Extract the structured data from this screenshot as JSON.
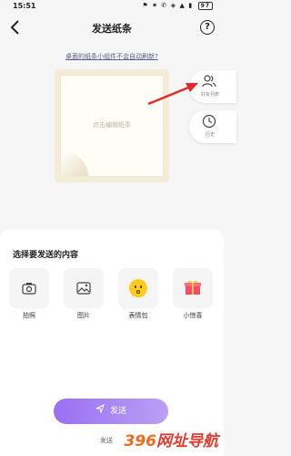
{
  "status_bar": {
    "time": "15:51",
    "icons": "⚑ ✷ ✆ ◈ ▲ ▮",
    "battery": "97"
  },
  "header": {
    "title": "发送纸条",
    "back_icon": "back-arrow-icon",
    "help_label": "?"
  },
  "notice": {
    "text": "桌面的纸条小组件不会自动刷新?"
  },
  "note": {
    "hint": "点击编辑纸条"
  },
  "side_actions": [
    {
      "label": "好友列表",
      "icon": "friends-icon"
    },
    {
      "label": "历史",
      "icon": "clock-icon"
    }
  ],
  "content_types": {
    "title": "选择要发送的内容",
    "items": [
      {
        "label": "拍照",
        "icon": "camera-icon"
      },
      {
        "label": "图片",
        "icon": "image-icon"
      },
      {
        "label": "表情包",
        "icon": "emoji-icon"
      },
      {
        "label": "小惊喜",
        "icon": "gift-icon"
      }
    ]
  },
  "send_button": {
    "label": "发送",
    "icon": "send-icon"
  },
  "bottom_text": "发送",
  "watermark": {
    "part1": "396",
    "part2": "网址导航"
  },
  "colors": {
    "accent": "#9a6ff2",
    "arrow": "#e32a2a",
    "note_bg": "#f3edd8"
  }
}
